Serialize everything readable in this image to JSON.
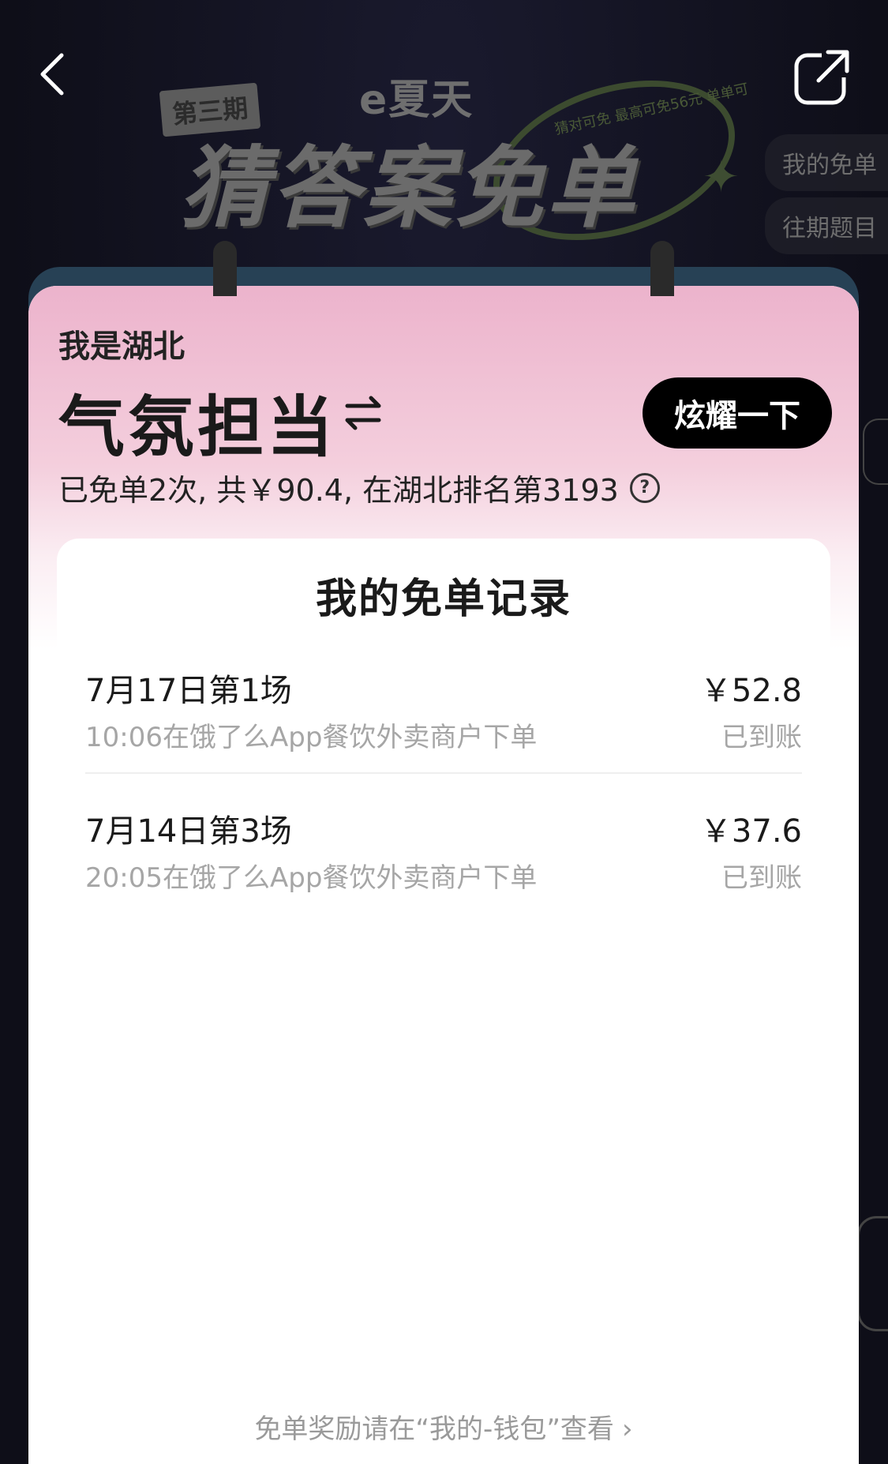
{
  "nav": {
    "back_icon": "chevron-left-icon",
    "share_icon": "share-icon"
  },
  "banner": {
    "brand": "e夏天",
    "issue": "第三期",
    "title": "猜答案免单",
    "ring_text": "猜对可免 最高可免56元 单单可"
  },
  "side_tabs": [
    "我的免单",
    "往期题目"
  ],
  "card": {
    "region": "我是湖北",
    "honor": "气氛担当",
    "show_off_label": "炫耀一下",
    "summary": "已免单2次, 共￥90.4, 在湖北排名第3193",
    "help_symbol": "?",
    "records_title": "我的免单记录",
    "records": [
      {
        "title": "7月17日第1场",
        "desc": "10:06在饿了么App餐饮外卖商户下单",
        "amount": "￥52.8",
        "status": "已到账"
      },
      {
        "title": "7月14日第3场",
        "desc": "20:05在饿了么App餐饮外卖商户下单",
        "amount": "￥37.6",
        "status": "已到账"
      }
    ],
    "footer_link": "免单奖励请在“我的-钱包”查看"
  },
  "colors": {
    "header_pink": "#ecb3cc",
    "button_black": "#000000",
    "muted_text": "#a6a6a6"
  }
}
